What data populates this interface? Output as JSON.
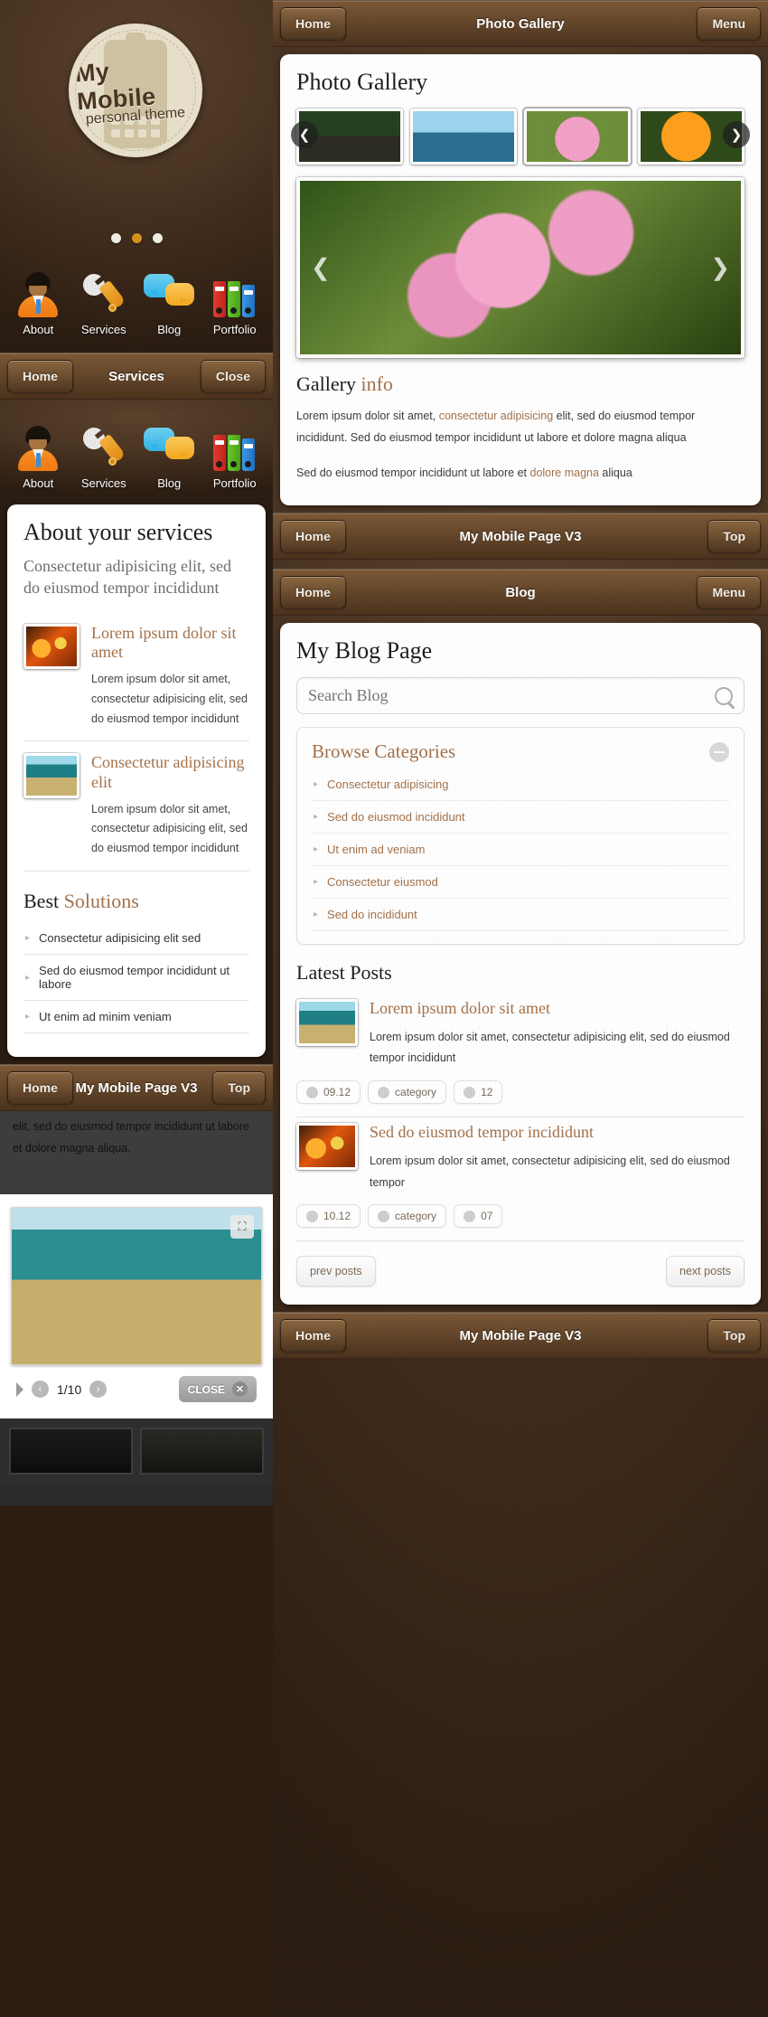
{
  "theme": {
    "accent": "#a3714a",
    "bar_brown": "#6b4a2c",
    "bg_brown": "#3a2718"
  },
  "hero": {
    "badge_line1": "My Mobile",
    "badge_line2": "personal theme",
    "dots": [
      "",
      "",
      ""
    ],
    "active_dot_index": 1
  },
  "icon_menu": [
    {
      "label": "About",
      "icon": "person-icon"
    },
    {
      "label": "Services",
      "icon": "wrench-icon"
    },
    {
      "label": "Blog",
      "icon": "speech-bubbles-icon"
    },
    {
      "label": "Portfolio",
      "icon": "binders-icon"
    }
  ],
  "services_toolbar": {
    "left": "Home",
    "title": "Services",
    "right": "Close"
  },
  "services_page": {
    "title": "About your services",
    "lead": "Consectetur adipisicing elit, sed do eiusmod tempor incididunt",
    "items": [
      {
        "title": "Lorem ipsum dolor sit amet",
        "text": "Lorem ipsum dolor sit amet, consectetur adipisicing elit, sed do eiusmod tempor incididunt",
        "thumb": "flower-thumb"
      },
      {
        "title": "Consectetur adipisicing elit",
        "text": "Lorem ipsum dolor sit amet, consectetur adipisicing elit, sed do eiusmod tempor incididunt",
        "thumb": "coast-thumb"
      }
    ],
    "section_title_plain": "Best ",
    "section_title_accent": "Solutions",
    "solutions": [
      "Consectetur adipisicing elit sed",
      "Sed do eiusmod tempor incididunt ut labore",
      "Ut enim ad minim veniam"
    ]
  },
  "left_footer_toolbar": {
    "left": "Home",
    "title": "My Mobile Page V3",
    "right": "Top"
  },
  "lightbox": {
    "dim_text": "elit, sed do eiusmod tempor incididunt ut labore et dolore magna aliqua.",
    "counter": "1/10",
    "close_label": "CLOSE",
    "expand_icon": "expand-icon",
    "play_icon": "play-icon",
    "prev_icon": "prev-icon",
    "next_icon": "next-icon"
  },
  "gallery_toolbar": {
    "left": "Home",
    "title": "Photo Gallery",
    "right": "Menu"
  },
  "gallery_page": {
    "title": "Photo Gallery",
    "thumbs": [
      {
        "name": "seagull-thumb",
        "selected": false
      },
      {
        "name": "sailboat-thumb",
        "selected": false
      },
      {
        "name": "pink-flowers-thumb",
        "selected": true
      },
      {
        "name": "orange-flower-thumb",
        "selected": false
      }
    ],
    "prev_icon": "chevron-left-icon",
    "next_icon": "chevron-right-icon",
    "hero_image": "pink-flowers-large",
    "info_title_plain": "Gallery ",
    "info_title_accent": "info",
    "paragraph1_a": "Lorem ipsum dolor sit amet, ",
    "paragraph1_link": "consectetur adipisicing",
    "paragraph1_b": " elit, sed do eiusmod tempor incididunt. Sed do eiusmod tempor incididunt ut labore et dolore magna aliqua",
    "paragraph2_a": "Sed do eiusmod tempor incididunt ut labore et ",
    "paragraph2_link": "dolore magna",
    "paragraph2_b": " aliqua"
  },
  "gallery_footer_toolbar": {
    "left": "Home",
    "title": "My Mobile Page V3",
    "right": "Top"
  },
  "blog_toolbar": {
    "left": "Home",
    "title": "Blog",
    "right": "Menu"
  },
  "blog_page": {
    "title": "My Blog Page",
    "search_placeholder": "Search Blog",
    "search_icon": "search-icon",
    "categories_title": "Browse Categories",
    "collapse_icon": "minus-icon",
    "categories": [
      "Consectetur adipisicing",
      "Sed do eiusmod incididunt",
      "Ut enim ad veniam",
      "Consectetur eiusmod",
      "Sed do incididunt"
    ],
    "latest_title": "Latest Posts",
    "posts": [
      {
        "title": "Lorem ipsum dolor sit amet",
        "excerpt": "Lorem ipsum dolor sit amet, consectetur adipisicing elit, sed do eiusmod tempor incididunt",
        "thumb": "coast-thumb",
        "date": "09.12",
        "category": "category",
        "comments": "12"
      },
      {
        "title": "Sed do eiusmod tempor incididunt",
        "excerpt": "Lorem ipsum dolor sit amet, consectetur adipisicing elit, sed do eiusmod tempor",
        "thumb": "flower-thumb",
        "date": "10.12",
        "category": "category",
        "comments": "07"
      }
    ],
    "prev_posts": "prev posts",
    "next_posts": "next posts"
  },
  "blog_footer_toolbar": {
    "left": "Home",
    "title": "My Mobile Page V3",
    "right": "Top"
  }
}
